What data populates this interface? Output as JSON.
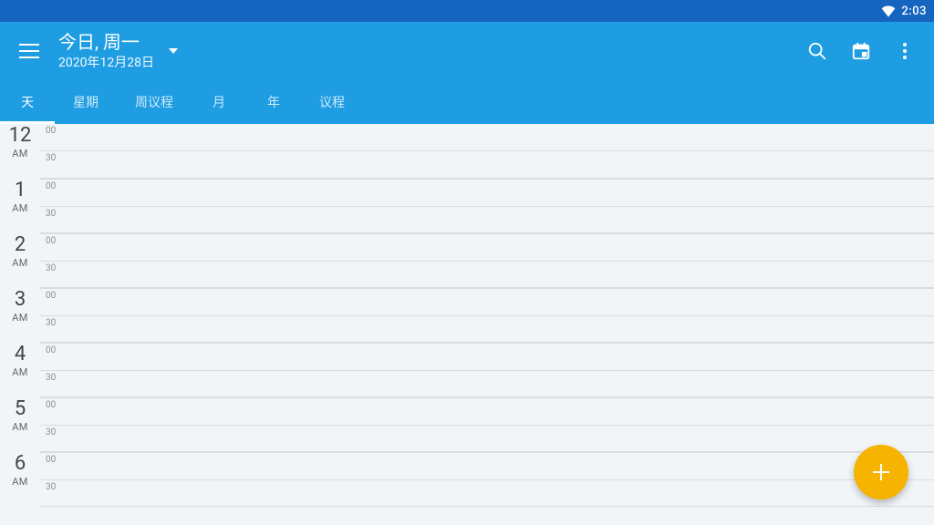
{
  "status": {
    "time": "2:03"
  },
  "header": {
    "title": "今日, 周一",
    "subtitle": "2020年12月28日"
  },
  "tabs": [
    {
      "label": "天",
      "selected": true
    },
    {
      "label": "星期",
      "selected": false
    },
    {
      "label": "周议程",
      "selected": false
    },
    {
      "label": "月",
      "selected": false
    },
    {
      "label": "年",
      "selected": false
    },
    {
      "label": "议程",
      "selected": false
    }
  ],
  "hours": [
    {
      "num": "12",
      "ampm": "AM"
    },
    {
      "num": "1",
      "ampm": "AM"
    },
    {
      "num": "2",
      "ampm": "AM"
    },
    {
      "num": "3",
      "ampm": "AM"
    },
    {
      "num": "4",
      "ampm": "AM"
    },
    {
      "num": "5",
      "ampm": "AM"
    },
    {
      "num": "6",
      "ampm": "AM"
    }
  ],
  "minute_labels": {
    "top": "00",
    "bottom": "30"
  }
}
